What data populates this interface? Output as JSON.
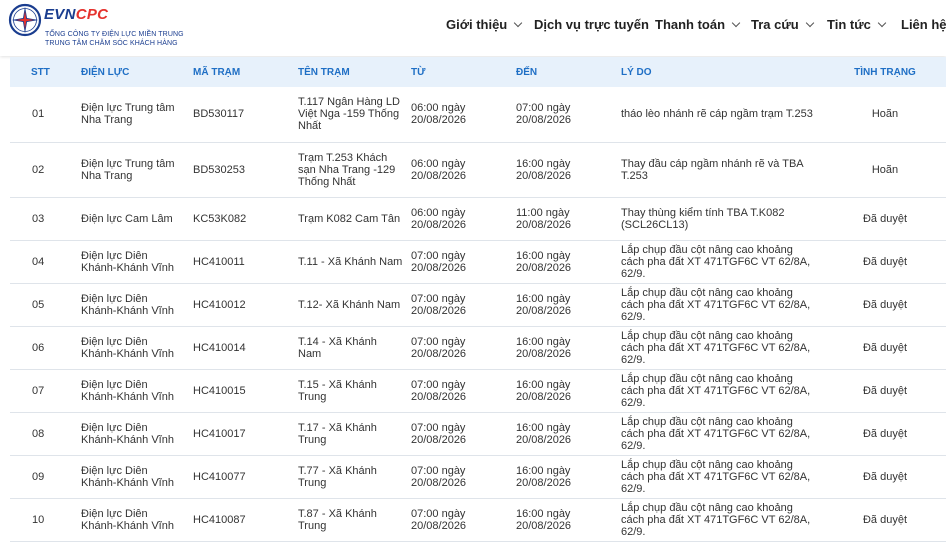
{
  "brand": {
    "name_evn": "EVN",
    "name_cpc": "CPC",
    "subtitle_line1": "TỔNG CÔNG TY ĐIỆN LỰC MIỀN TRUNG",
    "subtitle_line2": "TRUNG TÂM CHĂM SÓC KHÁCH HÀNG",
    "colors": {
      "blue": "#1a3d8f",
      "red": "#e5322d"
    }
  },
  "nav": {
    "items": [
      {
        "label": "Giới thiệu",
        "has_dropdown": true
      },
      {
        "label": "Dịch vụ trực tuyến",
        "has_dropdown": false
      },
      {
        "label": "Thanh toán",
        "has_dropdown": true
      },
      {
        "label": "Tra cứu",
        "has_dropdown": true
      },
      {
        "label": "Tin tức",
        "has_dropdown": true
      },
      {
        "label": "Liên hệ",
        "has_dropdown": false
      }
    ]
  },
  "table": {
    "header_color": "#1f6fc5",
    "header_bg": "#e7f1fb",
    "columns": [
      "STT",
      "ĐIỆN LỰC",
      "MÃ TRẠM",
      "TÊN TRẠM",
      "TỪ",
      "ĐẾN",
      "LÝ DO",
      "TÌNH TRẠNG"
    ],
    "rows": [
      {
        "stt": "01",
        "unit": "Điện lực Trung tâm Nha Trang",
        "code": "BD530117",
        "name": "T.117 Ngân Hàng LD Việt Nga -159 Thống Nhất",
        "from": "06:00 ngày 20/08/2026",
        "to": "07:00 ngày 20/08/2026",
        "reason": "tháo lèo nhánh rẽ cáp ngầm trạm T.253",
        "status": "Hoãn"
      },
      {
        "stt": "02",
        "unit": "Điện lực Trung tâm Nha Trang",
        "code": "BD530253",
        "name": "Trạm T.253 Khách sạn Nha Trang -129 Thống Nhất",
        "from": "06:00 ngày 20/08/2026",
        "to": "16:00 ngày 20/08/2026",
        "reason": "Thay đầu cáp ngầm nhánh rẽ và TBA T.253",
        "status": "Hoãn"
      },
      {
        "stt": "03",
        "unit": "Điện lực Cam Lâm",
        "code": "KC53K082",
        "name": "Trạm K082 Cam Tân",
        "from": "06:00 ngày 20/08/2026",
        "to": "11:00 ngày 20/08/2026",
        "reason": "Thay thùng kiểm tính TBA T.K082 (SCL26CL13)",
        "status": "Đã duyệt"
      },
      {
        "stt": "04",
        "unit": "Điện lực Diên Khánh-Khánh Vĩnh",
        "code": "HC410011",
        "name": "T.11 - Xã Khánh Nam",
        "from": "07:00 ngày 20/08/2026",
        "to": "16:00 ngày 20/08/2026",
        "reason": "Lắp chụp đầu cột nâng cao khoảng cách pha đất XT 471TGF6C VT 62/8A, 62/9.",
        "status": "Đã duyệt"
      },
      {
        "stt": "05",
        "unit": "Điện lực Diên Khánh-Khánh Vĩnh",
        "code": "HC410012",
        "name": "T.12- Xã Khánh Nam",
        "from": "07:00 ngày 20/08/2026",
        "to": "16:00 ngày 20/08/2026",
        "reason": "Lắp chụp đầu cột nâng cao khoảng cách pha đất XT 471TGF6C VT 62/8A, 62/9.",
        "status": "Đã duyệt"
      },
      {
        "stt": "06",
        "unit": "Điện lực Diên Khánh-Khánh Vĩnh",
        "code": "HC410014",
        "name": "T.14 - Xã Khánh Nam",
        "from": "07:00 ngày 20/08/2026",
        "to": "16:00 ngày 20/08/2026",
        "reason": "Lắp chụp đầu cột nâng cao khoảng cách pha đất XT 471TGF6C VT 62/8A, 62/9.",
        "status": "Đã duyệt"
      },
      {
        "stt": "07",
        "unit": "Điện lực Diên Khánh-Khánh Vĩnh",
        "code": "HC410015",
        "name": "T.15 - Xã Khánh Trung",
        "from": "07:00 ngày 20/08/2026",
        "to": "16:00 ngày 20/08/2026",
        "reason": "Lắp chụp đầu cột nâng cao khoảng cách pha đất XT 471TGF6C VT 62/8A, 62/9.",
        "status": "Đã duyệt"
      },
      {
        "stt": "08",
        "unit": "Điện lực Diên Khánh-Khánh Vĩnh",
        "code": "HC410017",
        "name": "T.17 - Xã Khánh Trung",
        "from": "07:00 ngày 20/08/2026",
        "to": "16:00 ngày 20/08/2026",
        "reason": "Lắp chụp đầu cột nâng cao khoảng cách pha đất XT 471TGF6C VT 62/8A, 62/9.",
        "status": "Đã duyệt"
      },
      {
        "stt": "09",
        "unit": "Điện lực Diên Khánh-Khánh Vĩnh",
        "code": "HC410077",
        "name": "T.77 - Xã Khánh Trung",
        "from": "07:00 ngày 20/08/2026",
        "to": "16:00 ngày 20/08/2026",
        "reason": "Lắp chụp đầu cột nâng cao khoảng cách pha đất XT 471TGF6C VT 62/8A, 62/9.",
        "status": "Đã duyệt"
      },
      {
        "stt": "10",
        "unit": "Điện lực Diên Khánh-Khánh Vĩnh",
        "code": "HC410087",
        "name": "T.87 - Xã Khánh Trung",
        "from": "07:00 ngày 20/08/2026",
        "to": "16:00 ngày 20/08/2026",
        "reason": "Lắp chụp đầu cột nâng cao khoảng cách pha đất XT 471TGF6C VT 62/8A, 62/9.",
        "status": "Đã duyệt"
      }
    ]
  }
}
